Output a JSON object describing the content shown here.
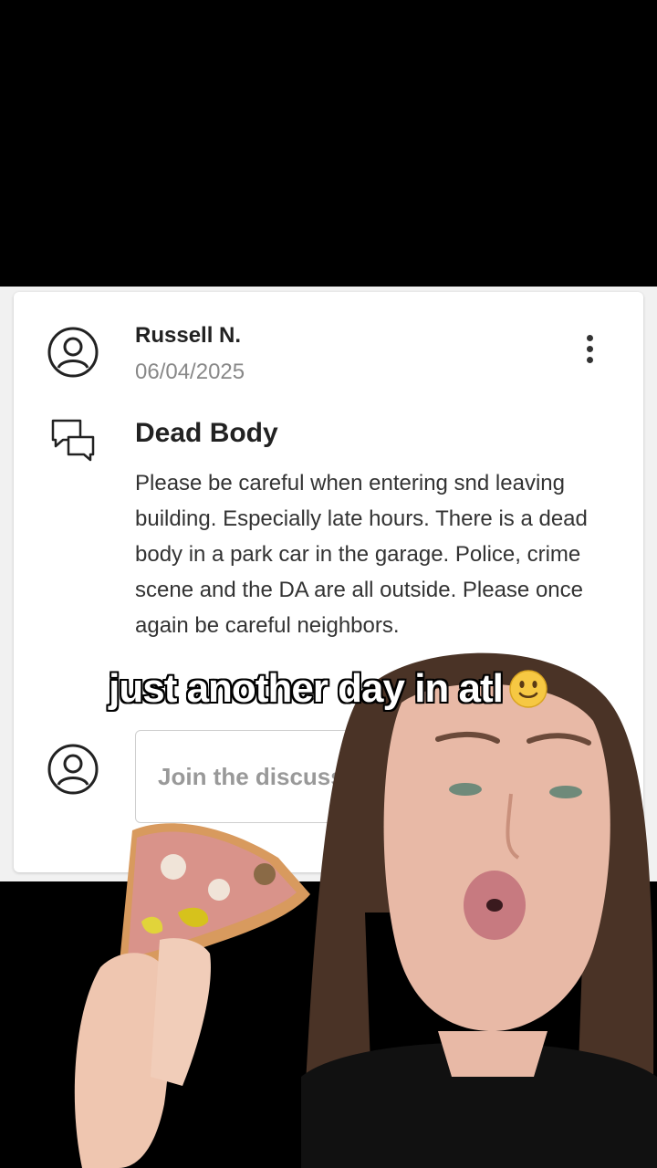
{
  "post": {
    "author_name": "Russell N.",
    "date": "06/04/2025",
    "title": "Dead Body",
    "body": "Please be careful when entering snd leaving building. Especially late hours. There is a dead body in a park car in the garage. Police, crime scene and the DA are all outside. Please once again be careful neighbors."
  },
  "comment_box": {
    "placeholder": "Join the discussion"
  },
  "overlay": {
    "caption": "just another day in atl",
    "caption_emoji": "slightly-smiling-face-emoji"
  },
  "colors": {
    "caption_text": "#ffffff",
    "caption_outline": "#000000",
    "card_background": "#ffffff",
    "page_background": "#f1f1f1",
    "muted_text": "#888888"
  }
}
